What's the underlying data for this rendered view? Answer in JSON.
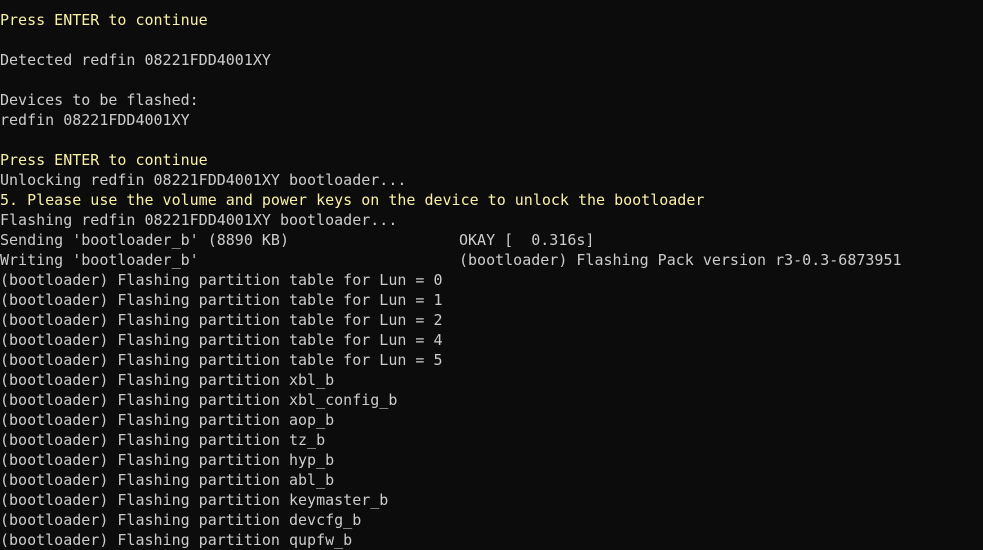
{
  "colors": {
    "background": "#0c0c0c",
    "normal": "#cccccc",
    "highlight": "#f9f1a5"
  },
  "lines": [
    {
      "text": "Press ENTER to continue",
      "color": "highlight"
    },
    {
      "text": "",
      "color": "normal"
    },
    {
      "text": "Detected redfin 08221FDD4001XY",
      "color": "normal"
    },
    {
      "text": "",
      "color": "normal"
    },
    {
      "text": "Devices to be flashed:",
      "color": "normal"
    },
    {
      "text": "redfin 08221FDD4001XY",
      "color": "normal"
    },
    {
      "text": "",
      "color": "normal"
    },
    {
      "text": "Press ENTER to continue",
      "color": "highlight"
    },
    {
      "text": "Unlocking redfin 08221FDD4001XY bootloader...",
      "color": "normal"
    },
    {
      "text": "5. Please use the volume and power keys on the device to unlock the bootloader",
      "color": "highlight"
    },
    {
      "text": "Flashing redfin 08221FDD4001XY bootloader...",
      "color": "normal"
    },
    {
      "text": "Sending 'bootloader_b' (8890 KB)",
      "right": "OKAY [  0.316s]",
      "color": "normal"
    },
    {
      "text": "Writing 'bootloader_b'",
      "right": "(bootloader) Flashing Pack version r3-0.3-6873951",
      "color": "normal"
    },
    {
      "text": "(bootloader) Flashing partition table for Lun = 0",
      "color": "normal"
    },
    {
      "text": "(bootloader) Flashing partition table for Lun = 1",
      "color": "normal"
    },
    {
      "text": "(bootloader) Flashing partition table for Lun = 2",
      "color": "normal"
    },
    {
      "text": "(bootloader) Flashing partition table for Lun = 4",
      "color": "normal"
    },
    {
      "text": "(bootloader) Flashing partition table for Lun = 5",
      "color": "normal"
    },
    {
      "text": "(bootloader) Flashing partition xbl_b",
      "color": "normal"
    },
    {
      "text": "(bootloader) Flashing partition xbl_config_b",
      "color": "normal"
    },
    {
      "text": "(bootloader) Flashing partition aop_b",
      "color": "normal"
    },
    {
      "text": "(bootloader) Flashing partition tz_b",
      "color": "normal"
    },
    {
      "text": "(bootloader) Flashing partition hyp_b",
      "color": "normal"
    },
    {
      "text": "(bootloader) Flashing partition abl_b",
      "color": "normal"
    },
    {
      "text": "(bootloader) Flashing partition keymaster_b",
      "color": "normal"
    },
    {
      "text": "(bootloader) Flashing partition devcfg_b",
      "color": "normal"
    },
    {
      "text": "(bootloader) Flashing partition qupfw_b",
      "color": "normal"
    }
  ]
}
